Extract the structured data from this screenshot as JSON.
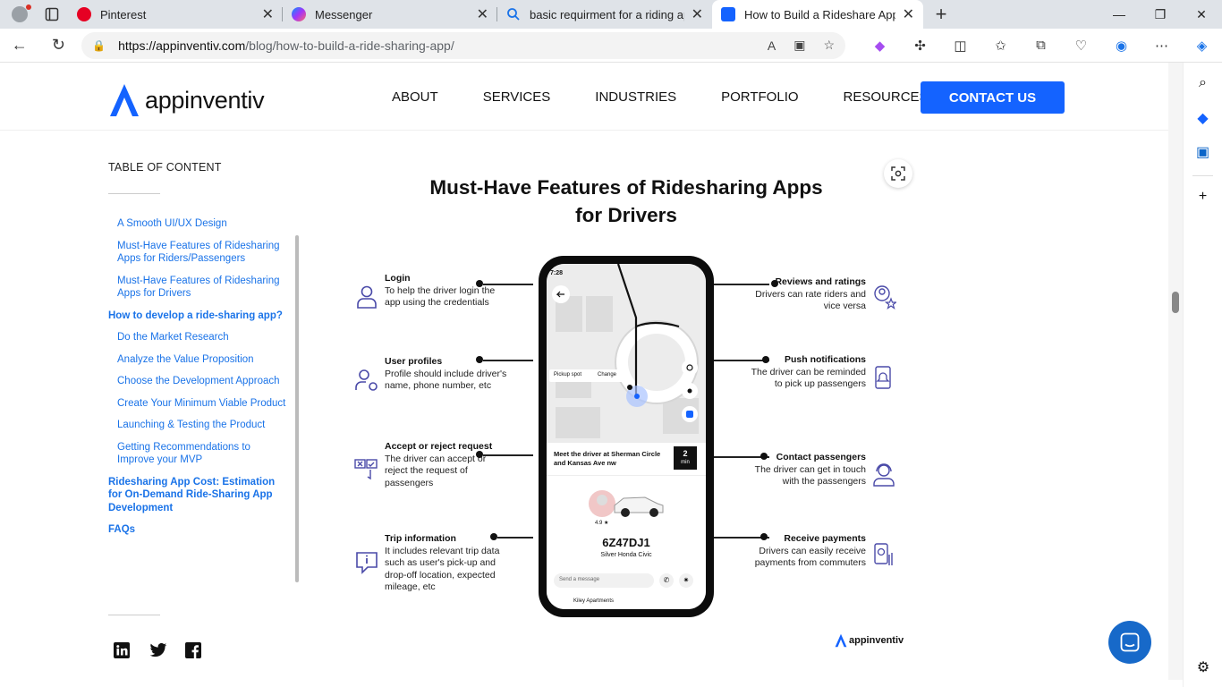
{
  "browser": {
    "tabs": [
      {
        "title": "Pinterest",
        "icon": "pinterest-icon"
      },
      {
        "title": "Messenger",
        "icon": "messenger-icon"
      },
      {
        "title": "basic requirment for a riding app",
        "icon": "search-icon"
      },
      {
        "title": "How to Build a Rideshare App? F",
        "icon": "appinventiv-icon",
        "active": true
      }
    ],
    "url_host": "https://appinventiv.com",
    "url_path": "/blog/how-to-build-a-ride-sharing-app/"
  },
  "site": {
    "logo_text": "appinventiv",
    "nav": [
      "ABOUT",
      "SERVICES",
      "INDUSTRIES",
      "PORTFOLIO",
      "RESOURCES"
    ],
    "contact_label": "CONTACT US",
    "accent": "#1463ff"
  },
  "toc": {
    "title": "TABLE OF CONTENT",
    "items": [
      {
        "label": "A Smooth UI/UX Design",
        "level": "sub"
      },
      {
        "label": "Must-Have Features of Ridesharing Apps for Riders/Passengers",
        "level": "sub"
      },
      {
        "label": "Must-Have Features of Ridesharing Apps for Drivers",
        "level": "sub"
      },
      {
        "label": "How to develop a ride-sharing app?",
        "level": "main"
      },
      {
        "label": "Do the Market Research",
        "level": "sub"
      },
      {
        "label": "Analyze the Value Proposition",
        "level": "sub"
      },
      {
        "label": "Choose the Development Approach",
        "level": "sub"
      },
      {
        "label": "Create Your Minimum Viable Product",
        "level": "sub"
      },
      {
        "label": "Launching & Testing the Product",
        "level": "sub"
      },
      {
        "label": "Getting Recommendations to Improve your MVP",
        "level": "sub"
      },
      {
        "label": "Ridesharing App Cost: Estimation for On-Demand Ride-Sharing App Development",
        "level": "main"
      },
      {
        "label": "FAQs",
        "level": "main"
      }
    ]
  },
  "infographic": {
    "title_line1": "Must-Have Features of Ridesharing Apps",
    "title_line2": "for Drivers",
    "left": [
      {
        "title": "Login",
        "desc": "To help the driver login the app using the credentials"
      },
      {
        "title": "User profiles",
        "desc": "Profile should include driver's name, phone number, etc"
      },
      {
        "title": "Accept or reject request",
        "desc": "The driver can accept or reject the request of passengers"
      },
      {
        "title": "Trip information",
        "desc": "It includes relevant trip data such as user's pick-up and drop-off location, expected mileage, etc"
      }
    ],
    "right": [
      {
        "title": "Reviews and ratings",
        "desc": "Drivers can rate riders and vice versa"
      },
      {
        "title": "Push notifications",
        "desc": "The driver can be reminded to pick up passengers"
      },
      {
        "title": "Contact passengers",
        "desc": "The driver can get in touch with the passengers"
      },
      {
        "title": "Receive payments",
        "desc": "Drivers can easily receive payments from commuters"
      }
    ],
    "phone": {
      "time": "7:28",
      "pickup": "Pickup spot",
      "change": "Change",
      "meet": "Meet the driver at Sherman Circle and Kansas Ave nw",
      "eta_num": "2",
      "eta_unit": "min",
      "rating": "4.9 ★",
      "plate": "6Z47DJ1",
      "car": "Silver Honda Civic",
      "message_placeholder": "Send a message",
      "bottom": "Kiley Apartments"
    },
    "brand": "appinventiv"
  }
}
